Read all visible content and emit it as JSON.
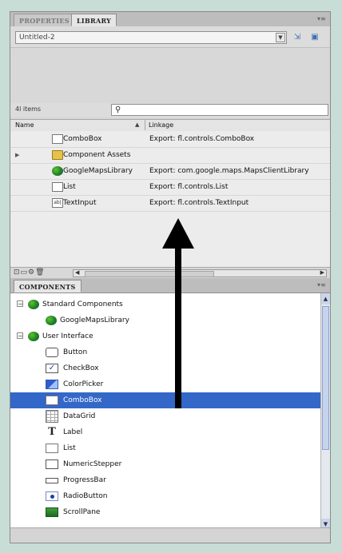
{
  "library_panel": {
    "tabs": [
      {
        "label": "PROPERTIES",
        "active": false
      },
      {
        "label": "LIBRARY",
        "active": true
      }
    ],
    "menu_icon": "panel-menu-icon",
    "document": "Untitled-2",
    "item_count": "4l items",
    "columns": {
      "name": "Name",
      "linkage": "Linkage"
    },
    "items": [
      {
        "name": "ComboBox",
        "linkage": "Export: fl.controls.ComboBox",
        "icon": "combobox-icon",
        "expandable": false
      },
      {
        "name": "Component Assets",
        "linkage": "",
        "icon": "folder-icon",
        "expandable": true
      },
      {
        "name": "GoogleMapsLibrary",
        "linkage": "Export: com.google.maps.MapsClientLibrary",
        "icon": "component-icon",
        "expandable": false
      },
      {
        "name": "List",
        "linkage": "Export: fl.controls.List",
        "icon": "list-icon",
        "expandable": false
      },
      {
        "name": "TextInput",
        "linkage": "Export: fl.controls.TextInput",
        "icon": "textinput-icon",
        "expandable": false
      }
    ]
  },
  "components_panel": {
    "tab": "COMPONENTS",
    "items": [
      {
        "label": "Standard Components",
        "level": 0,
        "expander": "−",
        "icon": "component-icon"
      },
      {
        "label": "GoogleMapsLibrary",
        "level": 1,
        "expander": "",
        "icon": "component-icon"
      },
      {
        "label": "User Interface",
        "level": 0,
        "expander": "−",
        "icon": "component-icon"
      },
      {
        "label": "Button",
        "level": 1,
        "expander": "",
        "icon": "button-icon"
      },
      {
        "label": "CheckBox",
        "level": 1,
        "expander": "",
        "icon": "checkbox-icon"
      },
      {
        "label": "ColorPicker",
        "level": 1,
        "expander": "",
        "icon": "colorpicker-icon"
      },
      {
        "label": "ComboBox",
        "level": 1,
        "expander": "",
        "icon": "combobox-icon",
        "selected": true
      },
      {
        "label": "DataGrid",
        "level": 1,
        "expander": "",
        "icon": "datagrid-icon"
      },
      {
        "label": "Label",
        "level": 1,
        "expander": "",
        "icon": "label-icon"
      },
      {
        "label": "List",
        "level": 1,
        "expander": "",
        "icon": "list-icon"
      },
      {
        "label": "NumericStepper",
        "level": 1,
        "expander": "",
        "icon": "numericstepper-icon"
      },
      {
        "label": "ProgressBar",
        "level": 1,
        "expander": "",
        "icon": "progressbar-icon"
      },
      {
        "label": "RadioButton",
        "level": 1,
        "expander": "",
        "icon": "radiobutton-icon"
      },
      {
        "label": "ScrollPane",
        "level": 1,
        "expander": "",
        "icon": "scrollpane-icon"
      }
    ]
  },
  "colors": {
    "selection": "#3468c8",
    "background": "#c8ddd5"
  }
}
